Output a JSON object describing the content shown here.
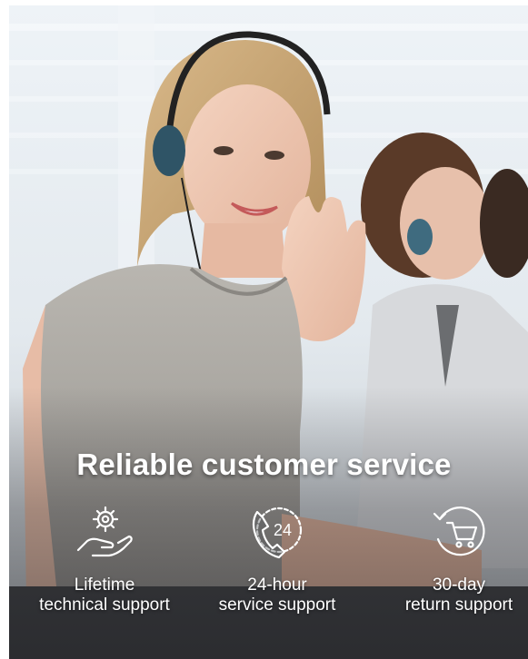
{
  "headline": "Reliable customer service",
  "features": [
    {
      "icon": "gear-hand-icon",
      "line1": "Lifetime",
      "line2": "technical support"
    },
    {
      "icon": "24-hour-phone-icon",
      "badge": "24",
      "line1": "24-hour",
      "line2": "service support"
    },
    {
      "icon": "cart-return-icon",
      "line1": "30-day",
      "line2": "return support"
    }
  ],
  "colors": {
    "text": "#ffffff",
    "icon_stroke": "#ffffff"
  }
}
